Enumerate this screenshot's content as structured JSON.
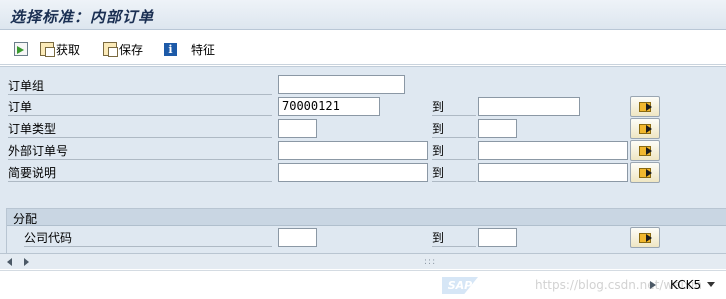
{
  "window": {
    "title": "选择标准：内部订单"
  },
  "toolbar": {
    "get_label": "获取",
    "save_label": "保存",
    "attr_label": "特征"
  },
  "form": {
    "to_label": "到",
    "rows": [
      {
        "label": "订单组",
        "from_value": "",
        "to_value": ""
      },
      {
        "label": "订单",
        "from_value": "70000121",
        "to_value": ""
      },
      {
        "label": "订单类型",
        "from_value": "",
        "to_value": ""
      },
      {
        "label": "外部订单号",
        "from_value": "",
        "to_value": ""
      },
      {
        "label": "简要说明",
        "from_value": "",
        "to_value": ""
      }
    ]
  },
  "assignment": {
    "title": "分配",
    "rows": [
      {
        "label": "公司代码",
        "from_value": "",
        "to_value": ""
      }
    ]
  },
  "statusbar": {
    "sap_logo": "SAP",
    "watermark": "https://blog.csdn.net/weixin",
    "tcode": "KCK5"
  }
}
